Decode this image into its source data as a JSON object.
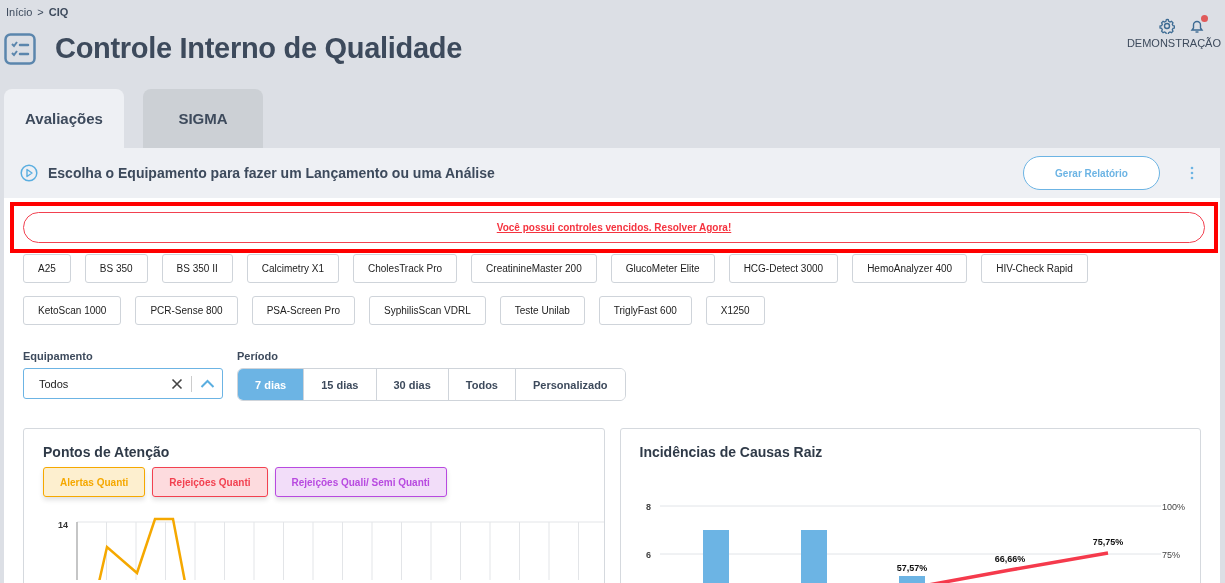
{
  "breadcrumb": {
    "link": "Início",
    "separator": ">",
    "current": "CIQ"
  },
  "page_title": "Controle Interno de Qualidade",
  "user": {
    "name": "DEMONSTRAÇÃO",
    "has_notifications": true
  },
  "tabs": [
    {
      "label": "Avaliações",
      "selected": true
    },
    {
      "label": "SIGMA",
      "selected": false
    }
  ],
  "toolbar": {
    "title": "Escolha o Equipamento para fazer um Lançamento ou uma Análise",
    "report_button": "Gerar Relatório"
  },
  "alert": {
    "message": "Você possui controles vencidos. Resolver Agora!",
    "highlighted": true
  },
  "equipment": [
    "A25",
    "BS 350",
    "BS 350 II",
    "Calcimetry X1",
    "CholesTrack Pro",
    "CreatinineMaster 200",
    "GlucoMeter Elite",
    "HCG-Detect 3000",
    "HemoAnalyzer 400",
    "HIV-Check Rapid",
    "KetoScan 1000",
    "PCR-Sense 800",
    "PSA-Screen Pro",
    "SyphilisScan VDRL",
    "Teste Unilab",
    "TriglyFast 600",
    "X1250"
  ],
  "filters": {
    "equipment": {
      "label": "Equipamento",
      "value": "Todos"
    },
    "period": {
      "label": "Período",
      "options": [
        {
          "label": "7 dias",
          "selected": true
        },
        {
          "label": "15 dias",
          "selected": false
        },
        {
          "label": "30 dias",
          "selected": false
        },
        {
          "label": "Todos",
          "selected": false
        },
        {
          "label": "Personalizado",
          "selected": false
        }
      ]
    }
  },
  "attention": {
    "title": "Pontos de Atenção",
    "legend": [
      {
        "label": "Alertas Quanti",
        "color": "#f5a800"
      },
      {
        "label": "Rejeições Quanti",
        "color": "#f24150"
      },
      {
        "label": "Rejeições Quali/ Semi Quanti",
        "color": "#b84ae0"
      }
    ],
    "y_tick": "14"
  },
  "causes": {
    "title": "Incidências de Causas Raiz",
    "left_ticks": [
      "8",
      "6"
    ],
    "right_ticks": [
      "100%",
      "75%"
    ],
    "value_labels": [
      "57,57%",
      "66,66%",
      "75,75%"
    ]
  }
}
